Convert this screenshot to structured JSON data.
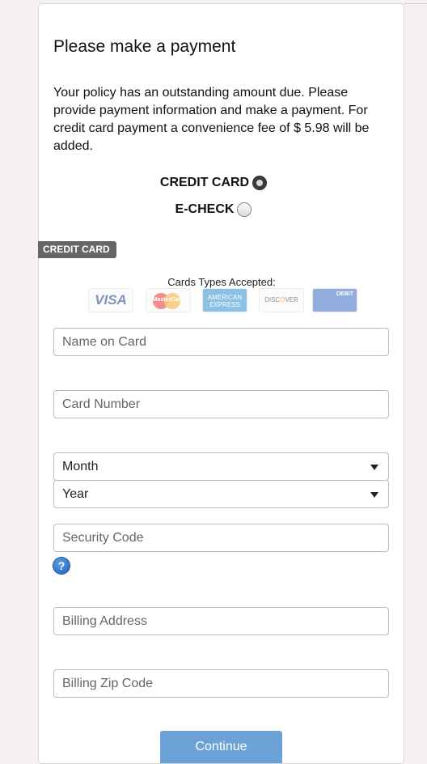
{
  "header": {
    "title": "Please make a payment",
    "description": "Your policy has an outstanding amount due. Please provide payment information and make a payment. For credit card payment a convenience fee of $ 5.98 will be added."
  },
  "payment_method": {
    "credit_card_label": "CREDIT CARD",
    "echeck_label": "E-CHECK",
    "selected": "CREDIT CARD"
  },
  "section": {
    "tag": "CREDIT CARD",
    "cards_accepted_label": "Cards Types Accepted:",
    "card_logos": {
      "visa": "VISA",
      "mastercard": "MasterCard",
      "amex": "AMERICAN EXPRESS",
      "discover_pre": "DISC",
      "discover_o": "O",
      "discover_post": "VER",
      "debit": "DEBIT"
    }
  },
  "form": {
    "name_placeholder": "Name on Card",
    "card_number_placeholder": "Card Number",
    "month_value": "Month",
    "year_value": "Year",
    "security_code_placeholder": "Security Code",
    "help_symbol": "?",
    "billing_address_placeholder": "Billing Address",
    "billing_zip_placeholder": "Billing Zip Code",
    "continue_label": "Continue"
  },
  "colors": {
    "continue_button": "#6ba3d8",
    "section_tag": "#666666",
    "help_icon": "#1b5fb3"
  }
}
